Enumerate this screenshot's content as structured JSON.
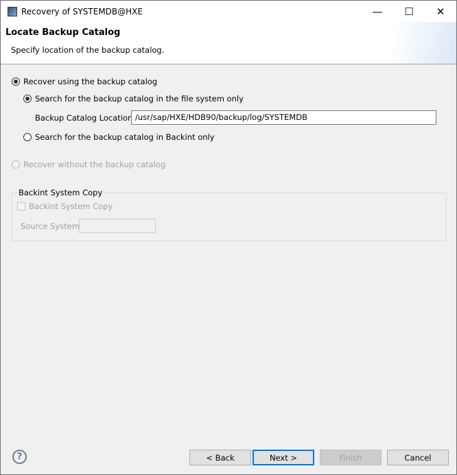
{
  "window": {
    "title": "Recovery of SYSTEMDB@HXE",
    "minimize": "—",
    "maximize": "☐",
    "close": "✕"
  },
  "header": {
    "title": "Locate Backup Catalog",
    "description": "Specify location of the backup catalog."
  },
  "options": {
    "recover_using_catalog": "Recover using the backup catalog",
    "search_file_system": "Search for the backup catalog in the file system only",
    "catalog_location_label": "Backup Catalog Location:",
    "catalog_location_value": "/usr/sap/HXE/HDB90/backup/log/SYSTEMDB",
    "search_backint": "Search for the backup catalog in Backint only",
    "recover_without_catalog": "Recover without the backup catalog"
  },
  "backint": {
    "group_label": "Backint System Copy",
    "checkbox_label": "Backint System Copy",
    "source_label": "Source System:",
    "source_value": ""
  },
  "footer": {
    "help": "?",
    "back": "< Back",
    "next": "Next >",
    "finish": "Finish",
    "cancel": "Cancel"
  }
}
